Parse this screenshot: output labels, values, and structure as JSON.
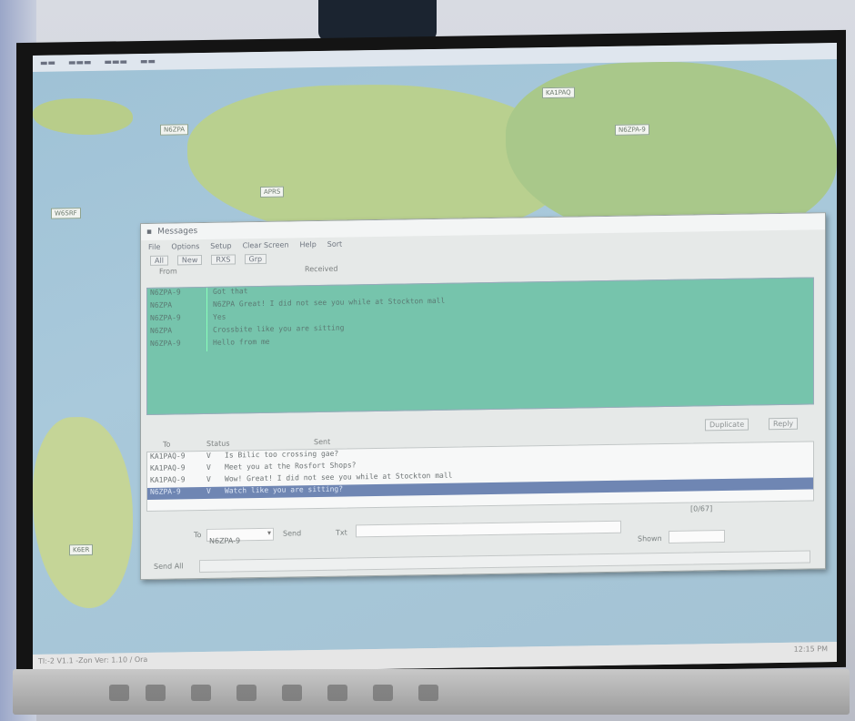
{
  "window": {
    "title": "Messages",
    "menu": [
      "File",
      "Options",
      "Setup",
      "Clear Screen",
      "Help",
      "Sort"
    ],
    "tabs": [
      "All",
      "New",
      "RXS",
      "Grp"
    ],
    "received_header": {
      "from": "From",
      "message": "Received"
    },
    "received": [
      {
        "from": "N6ZPA-9",
        "text": "Got that"
      },
      {
        "from": "N6ZPA",
        "text": "N6ZPA Great! I did not see you while at Stockton mall"
      },
      {
        "from": "N6ZPA-9",
        "text": "Yes"
      },
      {
        "from": "N6ZPA",
        "text": "Crossbite like you are sitting"
      },
      {
        "from": "N6ZPA-9",
        "text": "Hello from me"
      }
    ],
    "received_buttons": {
      "duplicate": "Duplicate",
      "reply": "Reply"
    },
    "sent_header": {
      "to": "To",
      "status": "Status",
      "sent": "Sent"
    },
    "sent": [
      {
        "to": "KA1PAQ-9",
        "status": "V",
        "text": "Is Bilic too crossing gae?"
      },
      {
        "to": "KA1PAQ-9",
        "status": "V",
        "text": "Meet you at the Rosfort Shops?"
      },
      {
        "to": "KA1PAQ-9",
        "status": "V",
        "text": "Wow! Great! I did not see you while at Stockton mall"
      },
      {
        "to": "N6ZPA-9",
        "status": "V",
        "text": "Watch like you are sitting?",
        "selected": true
      }
    ],
    "compose": {
      "to_label": "To",
      "to_value": "N6ZPA-9",
      "send_label": "Send",
      "msg_label": "Txt",
      "count": "[0/67]",
      "stay_label": "Shown",
      "bottom_label": "Send All"
    }
  },
  "map_labels": [
    "N6ZPA",
    "KA1PAQ",
    "N6ZPA-9",
    "APRS",
    "W6SRF",
    "K6ER"
  ],
  "statusbar": {
    "line1": "TI:-2 V1.1 -Zon Ver: 1.10 / Ora",
    "right": "12:15 PM"
  },
  "colors": {
    "received_bg": "#76c4ac",
    "selected_row": "#6f86b3",
    "screen_frame": "#141414"
  }
}
